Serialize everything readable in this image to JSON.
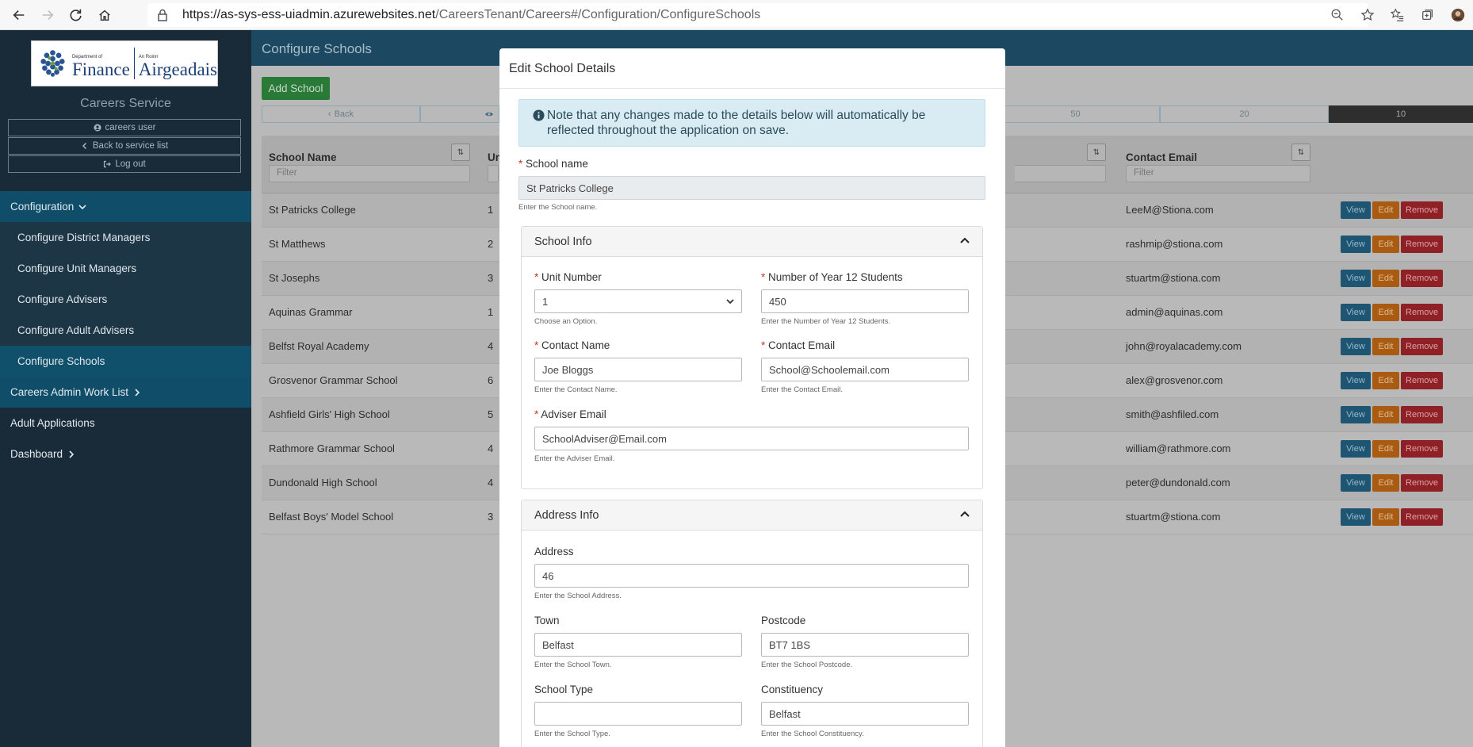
{
  "browser": {
    "url_host": "https://as-sys-ess-uiadmin.azurewebsites.net",
    "url_path": "/CareersTenant/Careers#/Configuration/ConfigureSchools"
  },
  "sidebar": {
    "logo_dept_small": "Department of",
    "logo_dept_big": "Finance",
    "logo_roinn_small": "An Roinn",
    "logo_roinn_big": "Airgeadais",
    "service_title": "Careers Service",
    "user_name": "careers user",
    "back_link": "Back to service list",
    "logout": "Log out",
    "menu": [
      {
        "label": "Configuration"
      },
      {
        "label": "Configure District Managers"
      },
      {
        "label": "Configure Unit Managers"
      },
      {
        "label": "Configure Advisers"
      },
      {
        "label": "Configure Adult Advisers"
      },
      {
        "label": "Configure Schools"
      },
      {
        "label": "Careers Admin Work List"
      },
      {
        "label": "Adult Applications"
      },
      {
        "label": "Dashboard"
      }
    ]
  },
  "main": {
    "page_title": "Configure Schools",
    "add_button": "Add School",
    "pager": {
      "back": "Back",
      "p50": "50",
      "p20": "20",
      "p10": "10"
    },
    "columns": {
      "school_name": "School Name",
      "unit": "Ur",
      "contact_email": "Contact Email",
      "filter_placeholder": "Filter"
    },
    "actions": {
      "view": "View",
      "edit": "Edit",
      "remove": "Remove"
    },
    "rows": [
      {
        "name": "St Patricks College",
        "unit": "1",
        "email": "LeeM@Stiona.com"
      },
      {
        "name": "St Matthews",
        "unit": "2",
        "email": "rashmip@stiona.com"
      },
      {
        "name": "St Josephs",
        "unit": "3",
        "email": "stuartm@stiona.com"
      },
      {
        "name": "Aquinas Grammar",
        "unit": "1",
        "email": "admin@aquinas.com"
      },
      {
        "name": "Belfst Royal Academy",
        "unit": "4",
        "email": "john@royalacademy.com"
      },
      {
        "name": "Grosvenor Grammar School",
        "unit": "6",
        "email": "alex@grosvenor.com"
      },
      {
        "name": "Ashfield Girls' High School",
        "unit": "5",
        "email": "smith@ashfiled.com"
      },
      {
        "name": "Rathmore Grammar School",
        "unit": "4",
        "email": "william@rathmore.com"
      },
      {
        "name": "Dundonald High School",
        "unit": "4",
        "email": "peter@dundonald.com"
      },
      {
        "name": "Belfast Boys' Model School",
        "unit": "3",
        "email": "stuartm@stiona.com"
      }
    ]
  },
  "modal": {
    "title": "Edit School Details",
    "note": "Note that any changes made to the details below will automatically be reflected throughout the application on save.",
    "school_name_label": "School name",
    "school_name_value": "St Patricks College",
    "school_name_hint": "Enter the School name.",
    "school_info_title": "School Info",
    "unit_number_label": "Unit Number",
    "unit_number_value": "1",
    "unit_number_hint": "Choose an Option.",
    "year12_label": "Number of Year 12 Students",
    "year12_value": "450",
    "year12_hint": "Enter the Number of Year 12 Students.",
    "contact_name_label": "Contact Name",
    "contact_name_value": "Joe Bloggs",
    "contact_name_hint": "Enter the Contact Name.",
    "contact_email_label": "Contact Email",
    "contact_email_value": "School@Schoolemail.com",
    "contact_email_hint": "Enter the Contact Email.",
    "adviser_email_label": "Adviser Email",
    "adviser_email_value": "SchoolAdviser@Email.com",
    "adviser_email_hint": "Enter the Adviser Email.",
    "address_info_title": "Address Info",
    "address_label": "Address",
    "address_value": "46",
    "address_hint": "Enter the School Address.",
    "town_label": "Town",
    "town_value": "Belfast",
    "town_hint": "Enter the School Town.",
    "postcode_label": "Postcode",
    "postcode_value": "BT7 1BS",
    "postcode_hint": "Enter the School Postcode.",
    "school_type_label": "School Type",
    "school_type_value": "",
    "school_type_hint": "Enter the School Type.",
    "constituency_label": "Constituency",
    "constituency_value": "Belfast",
    "constituency_hint": "Enter the School Constituency.",
    "required_mark": "*"
  }
}
